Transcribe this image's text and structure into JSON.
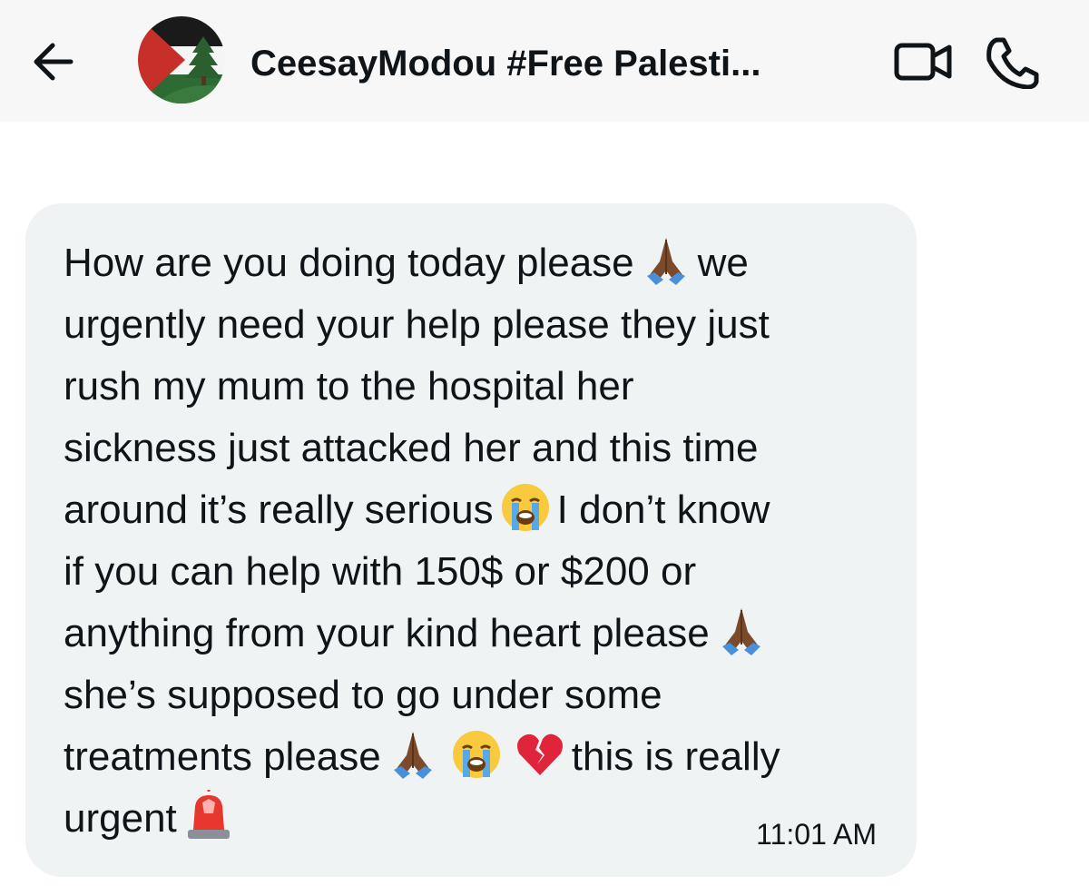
{
  "header": {
    "contact_name": "CeesayModou #Free Palesti...",
    "back_icon": "arrow-left-icon",
    "video_icon": "video-camera-icon",
    "phone_icon": "phone-icon",
    "background_color": "#f7f7f8"
  },
  "message": {
    "bubble_color": "#eff3f4",
    "lines": {
      "l1a": "How are you doing today please",
      "l1b": "we",
      "l2": "urgently need your help please they just",
      "l3": "rush my mum to the hospital her",
      "l4": "sickness just attacked her and this time",
      "l5a": "around it’s really serious",
      "l5b": "I don’t know",
      "l6": "if you can help with 150$ or $200 or",
      "l7a": "anything from your kind heart please",
      "l8": "she’s supposed to go under some",
      "l9a": "treatments please",
      "l9b": "this is really",
      "l10a": "urgent"
    },
    "emoji_icons": [
      "praying-hands-icon",
      "loudly-crying-face-icon",
      "broken-heart-icon",
      "police-light-icon"
    ],
    "timestamp": "11:01 AM"
  }
}
